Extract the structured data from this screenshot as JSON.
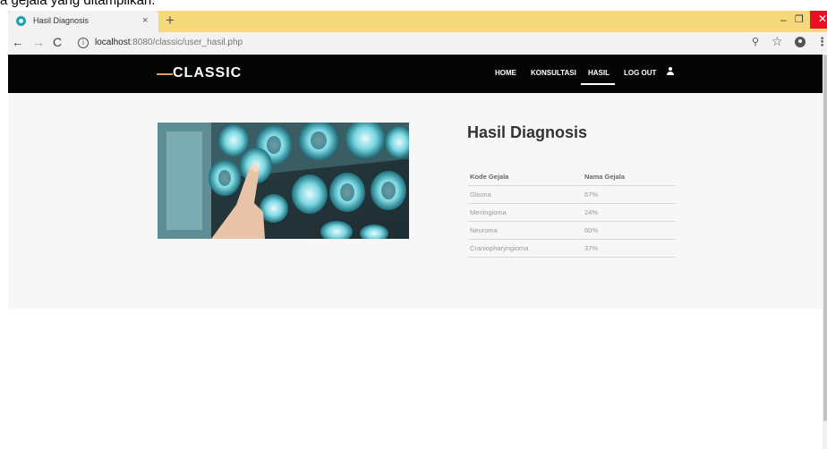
{
  "caption": "a gejala yang ditampilkan.",
  "browser": {
    "tab_title": "Hasil Diagnosis",
    "tab_close": "×",
    "new_tab": "+",
    "url_host": "localhost",
    "url_path": ":8080/classic/user_hasil.php",
    "icons": [
      "favicon-icon",
      "back-arrow-icon",
      "forward-arrow-icon",
      "reload-icon",
      "info-icon",
      "zoom-icon",
      "star-icon",
      "account-icon",
      "menu-icon",
      "minimize-icon",
      "maximize-icon",
      "close-icon"
    ],
    "glyphs": {
      "back": "←",
      "forward": "→",
      "reload": "C",
      "info": "i",
      "zoom": "⚲",
      "star": "☆",
      "menu": "⋮",
      "minimize": "–",
      "maximize": "❐",
      "close": "✕"
    }
  },
  "site": {
    "logo": "CLASSIC",
    "nav": [
      "HOME",
      "KONSULTASI",
      "HASIL",
      "LOG OUT"
    ],
    "active_nav": "HASIL",
    "accent_color": "#d9a066",
    "header_color": "#050505"
  },
  "main": {
    "title": "Hasil Diagnosis",
    "table": {
      "headers": [
        "Kode Gejala",
        "Nama Gejala"
      ],
      "rows": [
        [
          "Glioma",
          "67%"
        ],
        [
          "Meningioma",
          "24%"
        ],
        [
          "Neuroma",
          "60%"
        ],
        [
          "Craniopharyngioma",
          "37%"
        ]
      ]
    }
  }
}
